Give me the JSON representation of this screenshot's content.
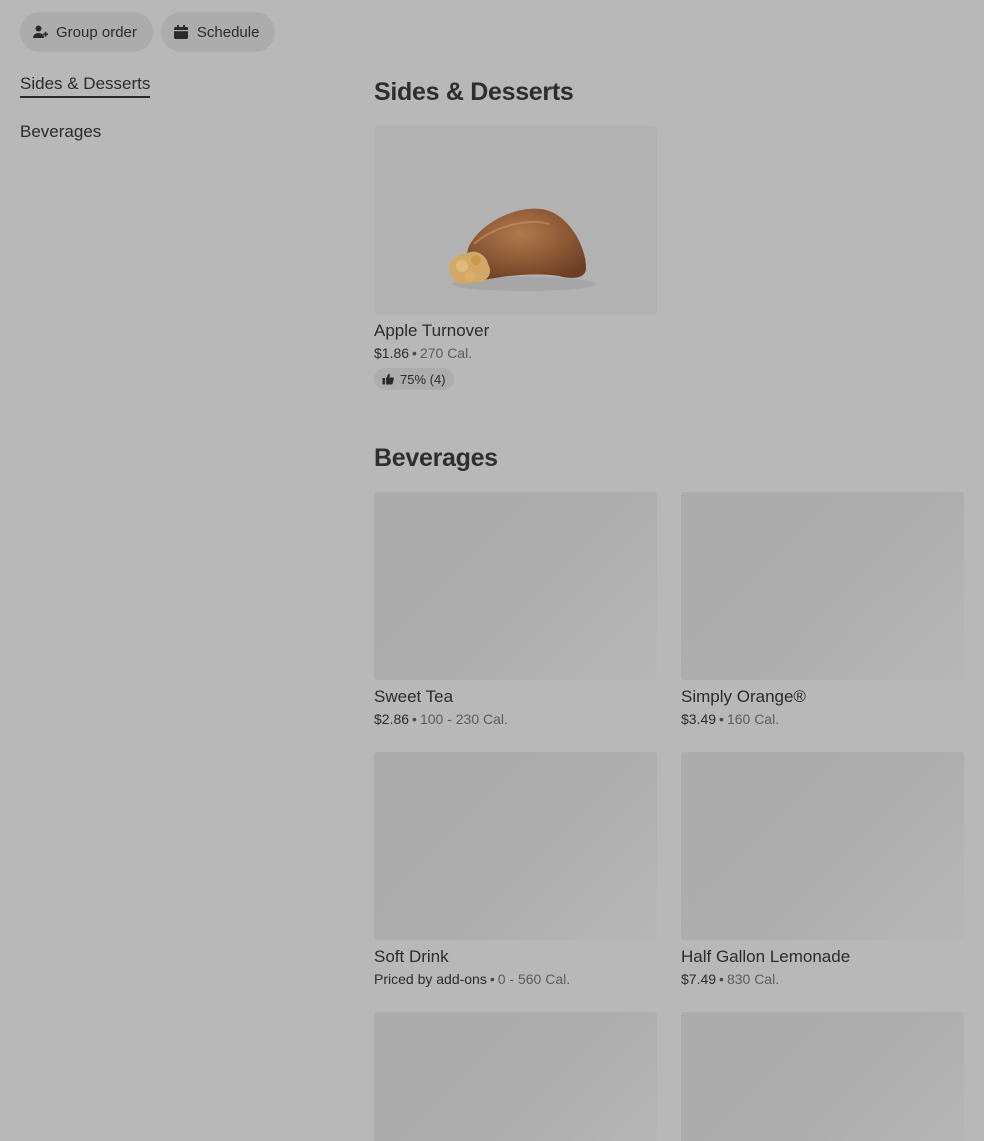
{
  "topbar": {
    "group_order": {
      "label": "Group order",
      "icon": "person-add-icon"
    },
    "schedule": {
      "label": "Schedule",
      "icon": "calendar-icon"
    }
  },
  "sidebar": {
    "items": [
      {
        "label": "Sides & Desserts",
        "active": true
      },
      {
        "label": "Beverages",
        "active": false
      }
    ]
  },
  "sections": {
    "sides": {
      "title": "Sides & Desserts",
      "items": [
        {
          "name": "Apple Turnover",
          "price": "$1.86",
          "calories": "270 Cal.",
          "rating": "75% (4)"
        }
      ]
    },
    "beverages": {
      "title": "Beverages",
      "items": [
        {
          "name": "Sweet Tea",
          "price": "$2.86",
          "calories": "100 - 230 Cal."
        },
        {
          "name": "Simply Orange®",
          "price": "$3.49",
          "calories": "160 Cal."
        },
        {
          "name": "Soft Drink",
          "price": "Priced by add-ons",
          "calories": "0 - 560 Cal."
        },
        {
          "name": "Half Gallon Lemonade",
          "price": "$7.49",
          "calories": "830 Cal."
        }
      ]
    }
  },
  "colors": {
    "background": "#b8b8b8",
    "text": "#2b2b2b",
    "muted": "#5c5c5c",
    "pill": "#acacac"
  }
}
